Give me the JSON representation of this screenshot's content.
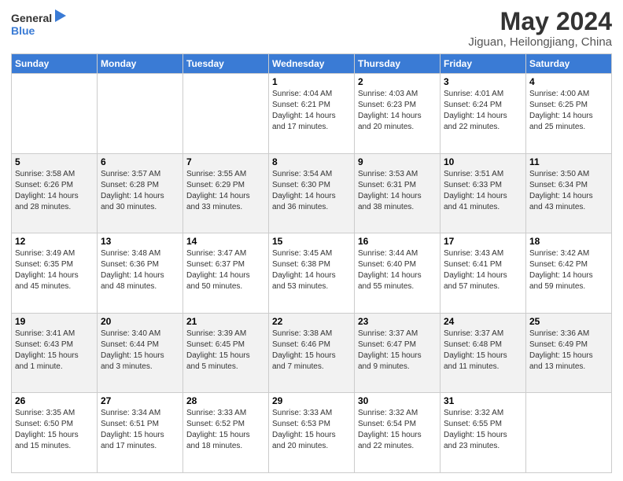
{
  "header": {
    "logo_general": "General",
    "logo_blue": "Blue",
    "month_title": "May 2024",
    "location": "Jiguan, Heilongjiang, China"
  },
  "days_of_week": [
    "Sunday",
    "Monday",
    "Tuesday",
    "Wednesday",
    "Thursday",
    "Friday",
    "Saturday"
  ],
  "weeks": [
    [
      {
        "day": "",
        "info": ""
      },
      {
        "day": "",
        "info": ""
      },
      {
        "day": "",
        "info": ""
      },
      {
        "day": "1",
        "info": "Sunrise: 4:04 AM\nSunset: 6:21 PM\nDaylight: 14 hours\nand 17 minutes."
      },
      {
        "day": "2",
        "info": "Sunrise: 4:03 AM\nSunset: 6:23 PM\nDaylight: 14 hours\nand 20 minutes."
      },
      {
        "day": "3",
        "info": "Sunrise: 4:01 AM\nSunset: 6:24 PM\nDaylight: 14 hours\nand 22 minutes."
      },
      {
        "day": "4",
        "info": "Sunrise: 4:00 AM\nSunset: 6:25 PM\nDaylight: 14 hours\nand 25 minutes."
      }
    ],
    [
      {
        "day": "5",
        "info": "Sunrise: 3:58 AM\nSunset: 6:26 PM\nDaylight: 14 hours\nand 28 minutes."
      },
      {
        "day": "6",
        "info": "Sunrise: 3:57 AM\nSunset: 6:28 PM\nDaylight: 14 hours\nand 30 minutes."
      },
      {
        "day": "7",
        "info": "Sunrise: 3:55 AM\nSunset: 6:29 PM\nDaylight: 14 hours\nand 33 minutes."
      },
      {
        "day": "8",
        "info": "Sunrise: 3:54 AM\nSunset: 6:30 PM\nDaylight: 14 hours\nand 36 minutes."
      },
      {
        "day": "9",
        "info": "Sunrise: 3:53 AM\nSunset: 6:31 PM\nDaylight: 14 hours\nand 38 minutes."
      },
      {
        "day": "10",
        "info": "Sunrise: 3:51 AM\nSunset: 6:33 PM\nDaylight: 14 hours\nand 41 minutes."
      },
      {
        "day": "11",
        "info": "Sunrise: 3:50 AM\nSunset: 6:34 PM\nDaylight: 14 hours\nand 43 minutes."
      }
    ],
    [
      {
        "day": "12",
        "info": "Sunrise: 3:49 AM\nSunset: 6:35 PM\nDaylight: 14 hours\nand 45 minutes."
      },
      {
        "day": "13",
        "info": "Sunrise: 3:48 AM\nSunset: 6:36 PM\nDaylight: 14 hours\nand 48 minutes."
      },
      {
        "day": "14",
        "info": "Sunrise: 3:47 AM\nSunset: 6:37 PM\nDaylight: 14 hours\nand 50 minutes."
      },
      {
        "day": "15",
        "info": "Sunrise: 3:45 AM\nSunset: 6:38 PM\nDaylight: 14 hours\nand 53 minutes."
      },
      {
        "day": "16",
        "info": "Sunrise: 3:44 AM\nSunset: 6:40 PM\nDaylight: 14 hours\nand 55 minutes."
      },
      {
        "day": "17",
        "info": "Sunrise: 3:43 AM\nSunset: 6:41 PM\nDaylight: 14 hours\nand 57 minutes."
      },
      {
        "day": "18",
        "info": "Sunrise: 3:42 AM\nSunset: 6:42 PM\nDaylight: 14 hours\nand 59 minutes."
      }
    ],
    [
      {
        "day": "19",
        "info": "Sunrise: 3:41 AM\nSunset: 6:43 PM\nDaylight: 15 hours\nand 1 minute."
      },
      {
        "day": "20",
        "info": "Sunrise: 3:40 AM\nSunset: 6:44 PM\nDaylight: 15 hours\nand 3 minutes."
      },
      {
        "day": "21",
        "info": "Sunrise: 3:39 AM\nSunset: 6:45 PM\nDaylight: 15 hours\nand 5 minutes."
      },
      {
        "day": "22",
        "info": "Sunrise: 3:38 AM\nSunset: 6:46 PM\nDaylight: 15 hours\nand 7 minutes."
      },
      {
        "day": "23",
        "info": "Sunrise: 3:37 AM\nSunset: 6:47 PM\nDaylight: 15 hours\nand 9 minutes."
      },
      {
        "day": "24",
        "info": "Sunrise: 3:37 AM\nSunset: 6:48 PM\nDaylight: 15 hours\nand 11 minutes."
      },
      {
        "day": "25",
        "info": "Sunrise: 3:36 AM\nSunset: 6:49 PM\nDaylight: 15 hours\nand 13 minutes."
      }
    ],
    [
      {
        "day": "26",
        "info": "Sunrise: 3:35 AM\nSunset: 6:50 PM\nDaylight: 15 hours\nand 15 minutes."
      },
      {
        "day": "27",
        "info": "Sunrise: 3:34 AM\nSunset: 6:51 PM\nDaylight: 15 hours\nand 17 minutes."
      },
      {
        "day": "28",
        "info": "Sunrise: 3:33 AM\nSunset: 6:52 PM\nDaylight: 15 hours\nand 18 minutes."
      },
      {
        "day": "29",
        "info": "Sunrise: 3:33 AM\nSunset: 6:53 PM\nDaylight: 15 hours\nand 20 minutes."
      },
      {
        "day": "30",
        "info": "Sunrise: 3:32 AM\nSunset: 6:54 PM\nDaylight: 15 hours\nand 22 minutes."
      },
      {
        "day": "31",
        "info": "Sunrise: 3:32 AM\nSunset: 6:55 PM\nDaylight: 15 hours\nand 23 minutes."
      },
      {
        "day": "",
        "info": ""
      }
    ]
  ]
}
